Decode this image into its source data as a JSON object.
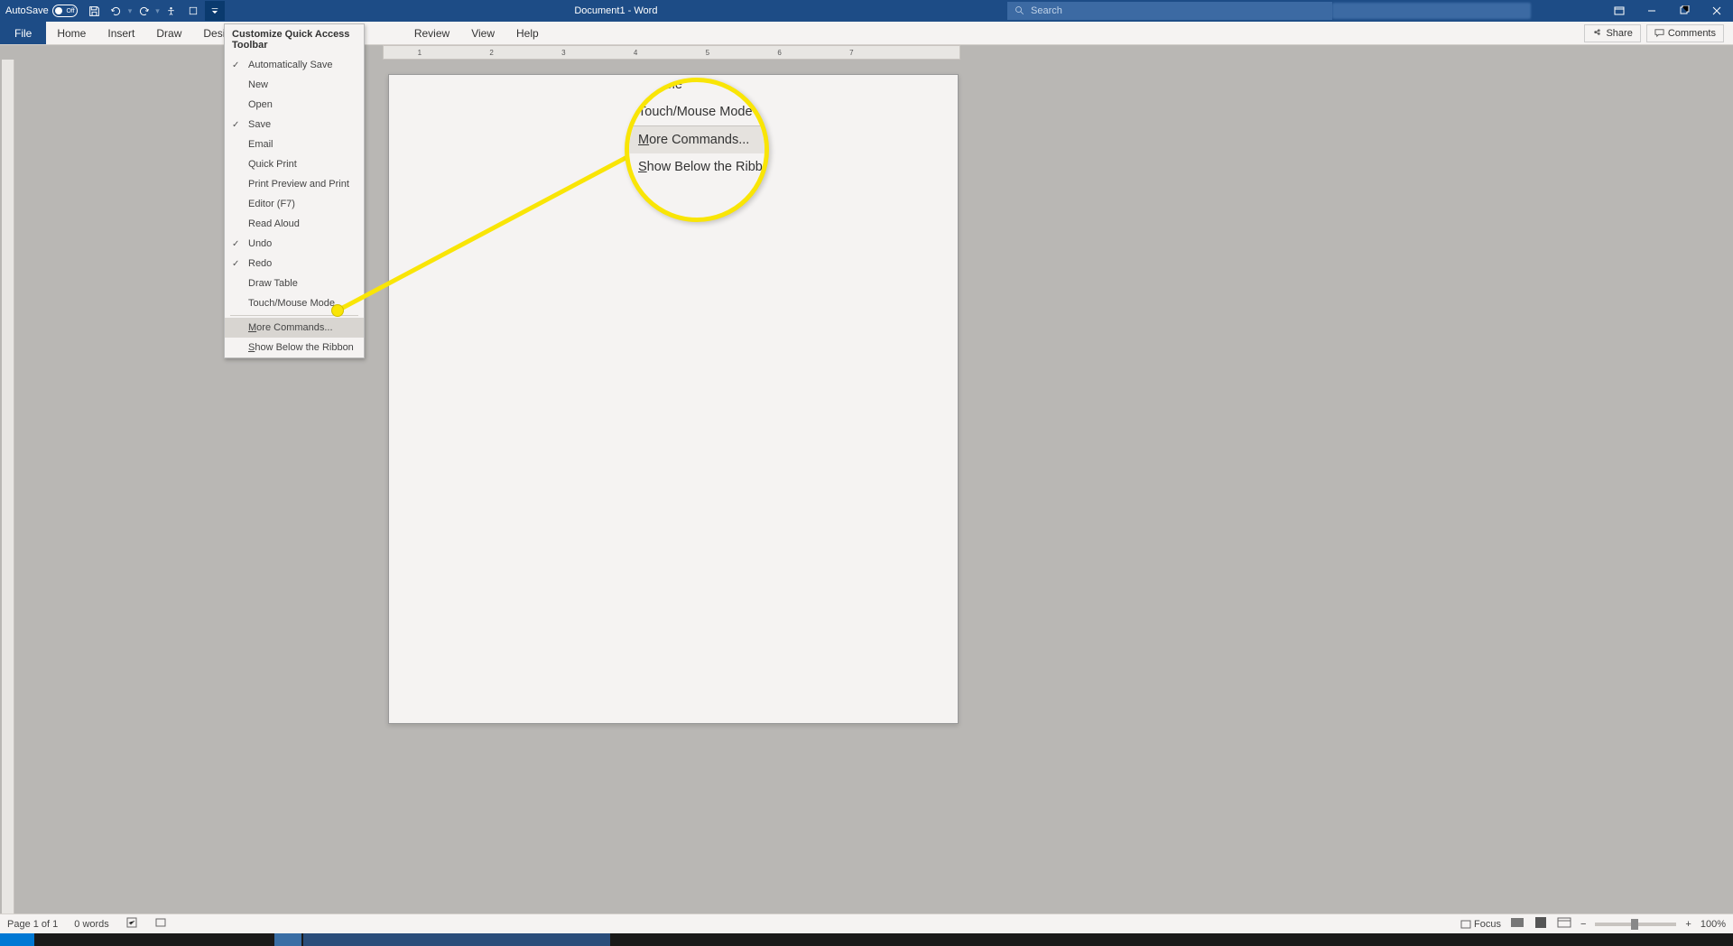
{
  "titlebar": {
    "autosave_label": "AutoSave",
    "autosave_state": "Off",
    "document_title": "Document1 - Word",
    "search_placeholder": "Search"
  },
  "ribbon": {
    "tabs": {
      "file": "File",
      "home": "Home",
      "insert": "Insert",
      "draw": "Draw",
      "design": "Design",
      "review": "Review",
      "view": "View",
      "help": "Help"
    },
    "share": "Share",
    "comments": "Comments"
  },
  "dropdown": {
    "header": "Customize Quick Access Toolbar",
    "items": {
      "auto_save": "Automatically Save",
      "new": "New",
      "open": "Open",
      "save": "Save",
      "email": "Email",
      "quick_print": "Quick Print",
      "print_preview": "Print Preview and Print",
      "editor": "Editor (F7)",
      "read_aloud": "Read Aloud",
      "undo": "Undo",
      "redo": "Redo",
      "draw_table": "Draw Table",
      "touch_mouse": "Touch/Mouse Mode",
      "more_commands": "More Commands...",
      "show_below": "Show Below the Ribbon"
    }
  },
  "zoom_callout": {
    "row0": "w Table",
    "row1": "Touch/Mouse Mode",
    "row2_prefix": "M",
    "row2_rest": "ore Commands...",
    "row3_prefix": "S",
    "row3_rest": "how Below the Ribb"
  },
  "ruler": {
    "n1": "1",
    "n2": "2",
    "n3": "3",
    "n4": "4",
    "n5": "5",
    "n6": "6",
    "n7": "7"
  },
  "statusbar": {
    "page": "Page 1 of 1",
    "words": "0 words",
    "focus": "Focus",
    "zoom": "100%"
  }
}
